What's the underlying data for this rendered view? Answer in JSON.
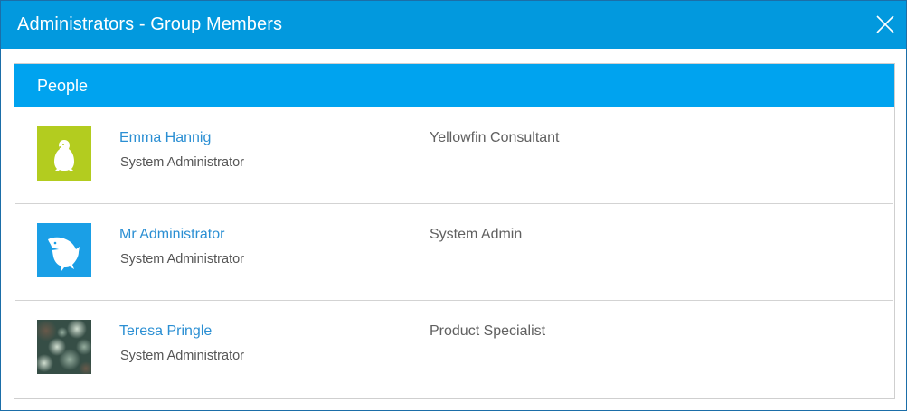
{
  "dialog": {
    "title": "Administrators - Group Members",
    "close_icon": "close-icon"
  },
  "panel": {
    "title": "People"
  },
  "members": [
    {
      "name": "Emma Hannig",
      "role": "System Administrator",
      "job": "Yellowfin Consultant",
      "avatar_icon": "penguin-icon",
      "avatar_color": "#b3cc1f"
    },
    {
      "name": "Mr Administrator",
      "role": "System Administrator",
      "job": "System Admin",
      "avatar_icon": "shark-icon",
      "avatar_color": "#1a9fe6"
    },
    {
      "name": "Teresa Pringle",
      "role": "System Administrator",
      "job": "Product Specialist",
      "avatar_icon": "photo-avatar",
      "avatar_color": "#3c5a4f"
    }
  ],
  "colors": {
    "titlebar": "#0299de",
    "panel_header": "#00a3ef",
    "link": "#2b8fd3"
  }
}
